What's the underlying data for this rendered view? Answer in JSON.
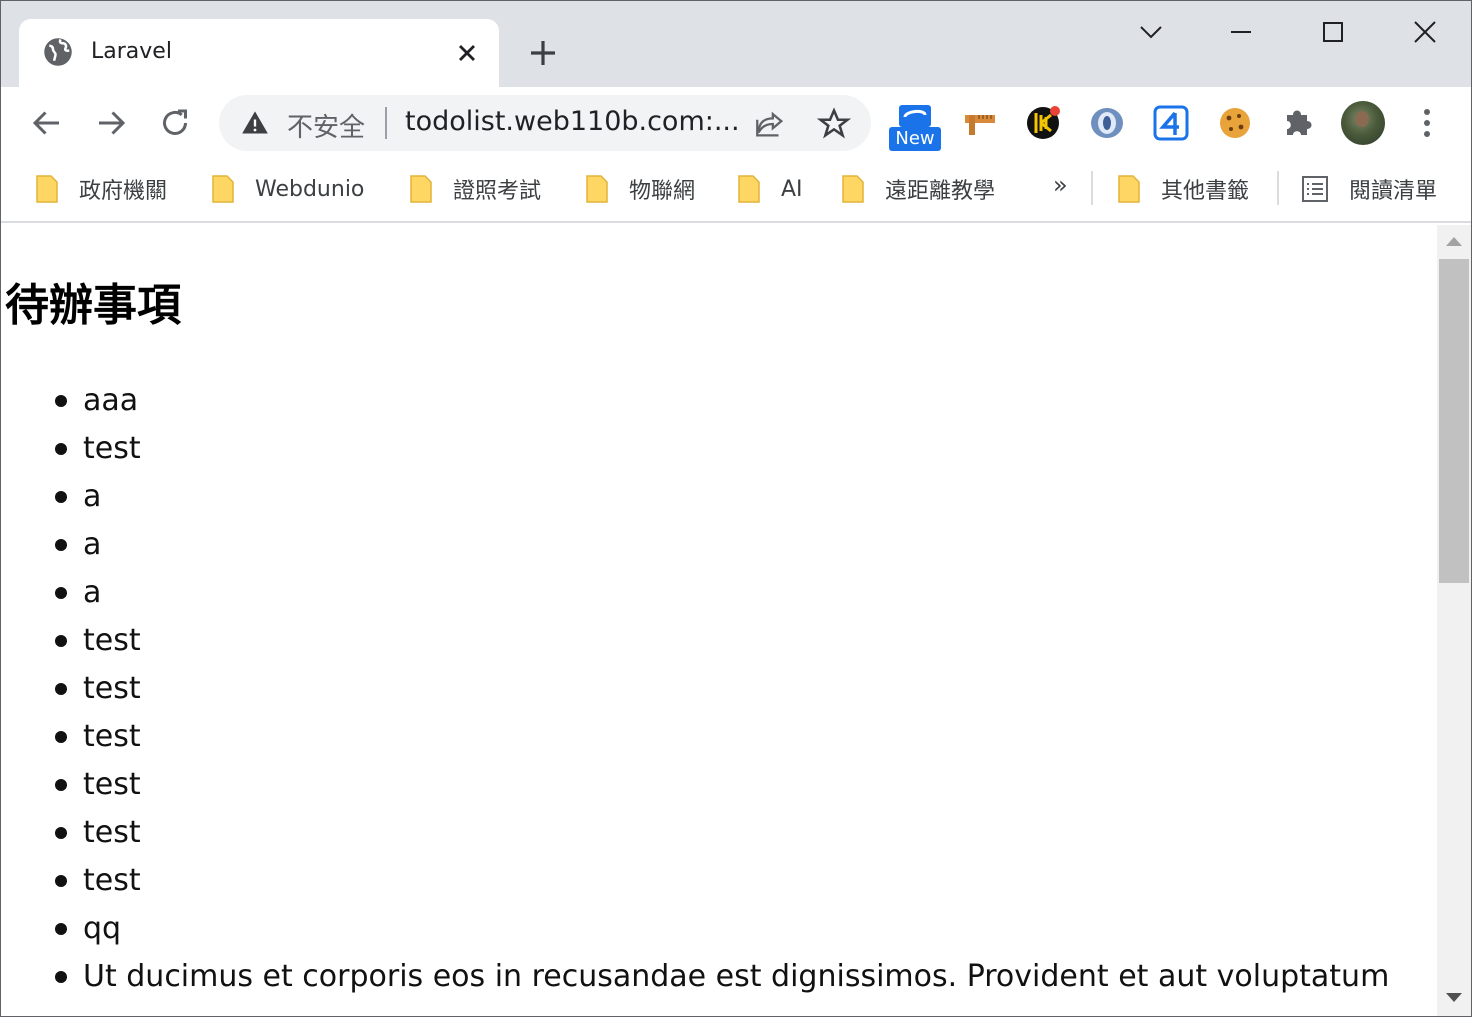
{
  "browser": {
    "tab": {
      "title": "Laravel",
      "icon": "globe-icon"
    },
    "window_controls": [
      "tab-search",
      "minimize",
      "maximize",
      "close"
    ]
  },
  "toolbar": {
    "security_label": "不安全",
    "url": "todolist.web110b.com:...",
    "extensions": [
      {
        "name": "new-badge-extension",
        "badge": "New"
      },
      {
        "name": "ruler-extension"
      },
      {
        "name": "keeper-extension"
      },
      {
        "name": "ring-extension"
      },
      {
        "name": "four-extension"
      },
      {
        "name": "cookie-extension"
      },
      {
        "name": "puzzle-icon"
      }
    ]
  },
  "bookmarks": {
    "items": [
      "政府機關",
      "Webdunio",
      "證照考試",
      "物聯網",
      "AI",
      "遠距離教學"
    ],
    "overflow": "»",
    "other": "其他書籤",
    "reading_list": "閱讀清單"
  },
  "page": {
    "heading": "待辦事項",
    "todos": [
      "aaa",
      "test",
      "a",
      "a",
      "a",
      "test",
      "test",
      "test",
      "test",
      "test",
      "test",
      "qq",
      "Ut ducimus et corporis eos in recusandae est dignissimos. Provident et aut voluptatum"
    ]
  },
  "colors": {
    "titlebar": "#dee1e6",
    "omnibox": "#f1f3f4",
    "folder": "#fdd663",
    "accent": "#1a73e8"
  }
}
